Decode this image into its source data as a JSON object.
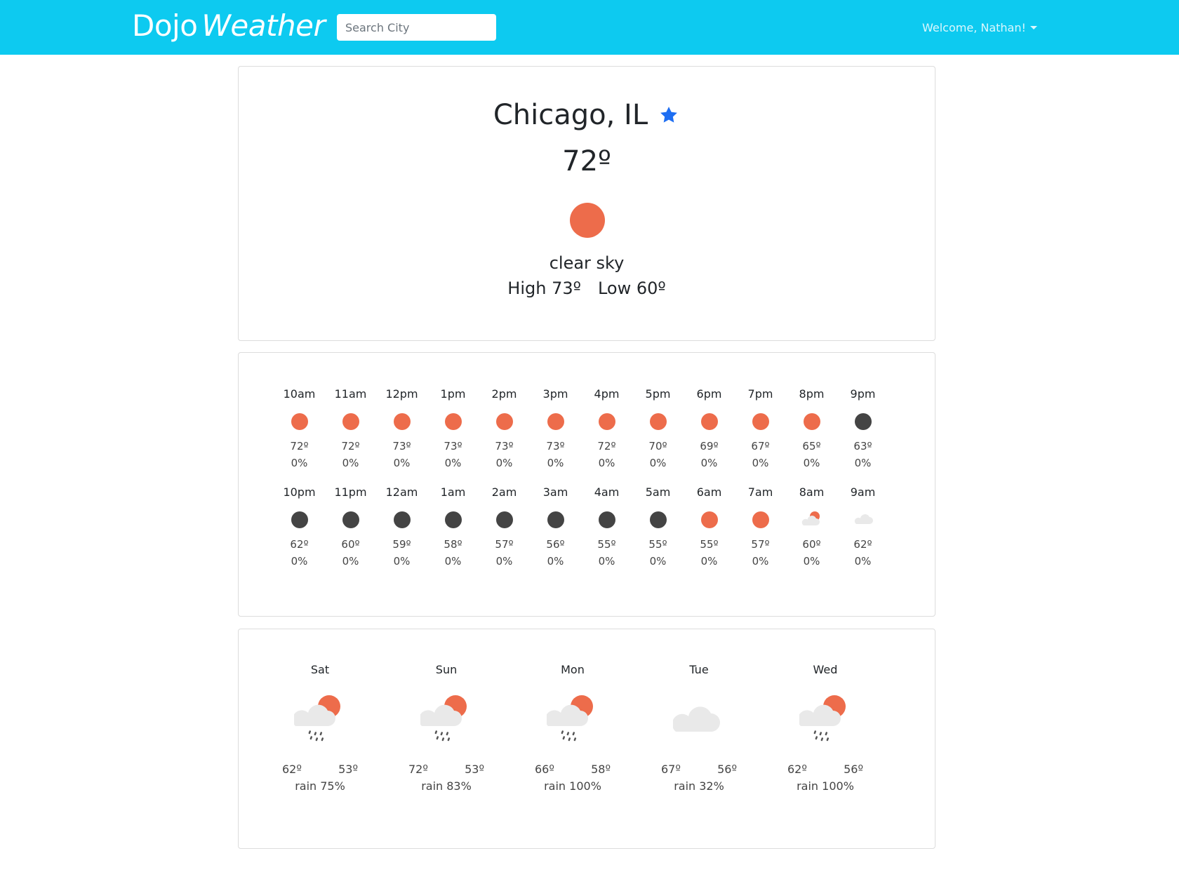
{
  "nav": {
    "brand_part1": "Dojo",
    "brand_part2": "Weather",
    "search_placeholder": "Search City",
    "welcome": "Welcome, Nathan!"
  },
  "current": {
    "city": "Chicago, IL",
    "temp": "72º",
    "icon": "sun-icon",
    "description": "clear sky",
    "high": "High 73º",
    "low": "Low 60º",
    "favorite_icon": "star-icon"
  },
  "hourly": [
    {
      "time": "10am",
      "icon": "sun",
      "temp": "72º",
      "pop": "0%"
    },
    {
      "time": "11am",
      "icon": "sun",
      "temp": "72º",
      "pop": "0%"
    },
    {
      "time": "12pm",
      "icon": "sun",
      "temp": "73º",
      "pop": "0%"
    },
    {
      "time": "1pm",
      "icon": "sun",
      "temp": "73º",
      "pop": "0%"
    },
    {
      "time": "2pm",
      "icon": "sun",
      "temp": "73º",
      "pop": "0%"
    },
    {
      "time": "3pm",
      "icon": "sun",
      "temp": "73º",
      "pop": "0%"
    },
    {
      "time": "4pm",
      "icon": "sun",
      "temp": "72º",
      "pop": "0%"
    },
    {
      "time": "5pm",
      "icon": "sun",
      "temp": "70º",
      "pop": "0%"
    },
    {
      "time": "6pm",
      "icon": "sun",
      "temp": "69º",
      "pop": "0%"
    },
    {
      "time": "7pm",
      "icon": "sun",
      "temp": "67º",
      "pop": "0%"
    },
    {
      "time": "8pm",
      "icon": "sun",
      "temp": "65º",
      "pop": "0%"
    },
    {
      "time": "9pm",
      "icon": "moon",
      "temp": "63º",
      "pop": "0%"
    },
    {
      "time": "10pm",
      "icon": "moon",
      "temp": "62º",
      "pop": "0%"
    },
    {
      "time": "11pm",
      "icon": "moon",
      "temp": "60º",
      "pop": "0%"
    },
    {
      "time": "12am",
      "icon": "moon",
      "temp": "59º",
      "pop": "0%"
    },
    {
      "time": "1am",
      "icon": "moon",
      "temp": "58º",
      "pop": "0%"
    },
    {
      "time": "2am",
      "icon": "moon",
      "temp": "57º",
      "pop": "0%"
    },
    {
      "time": "3am",
      "icon": "moon",
      "temp": "56º",
      "pop": "0%"
    },
    {
      "time": "4am",
      "icon": "moon",
      "temp": "55º",
      "pop": "0%"
    },
    {
      "time": "5am",
      "icon": "moon",
      "temp": "55º",
      "pop": "0%"
    },
    {
      "time": "6am",
      "icon": "sun",
      "temp": "55º",
      "pop": "0%"
    },
    {
      "time": "7am",
      "icon": "sun",
      "temp": "57º",
      "pop": "0%"
    },
    {
      "time": "8am",
      "icon": "partly-cloudy",
      "temp": "60º",
      "pop": "0%"
    },
    {
      "time": "9am",
      "icon": "cloud",
      "temp": "62º",
      "pop": "0%"
    }
  ],
  "daily": [
    {
      "day": "Sat",
      "icon": "rain-sun",
      "high": "62º",
      "low": "53º",
      "cond": "rain 75%"
    },
    {
      "day": "Sun",
      "icon": "rain-sun",
      "high": "72º",
      "low": "53º",
      "cond": "rain 83%"
    },
    {
      "day": "Mon",
      "icon": "rain-sun",
      "high": "66º",
      "low": "58º",
      "cond": "rain 100%"
    },
    {
      "day": "Tue",
      "icon": "cloud",
      "high": "67º",
      "low": "56º",
      "cond": "rain 32%"
    },
    {
      "day": "Wed",
      "icon": "rain-sun",
      "high": "62º",
      "low": "56º",
      "cond": "rain 100%"
    }
  ],
  "colors": {
    "navbar": "#0dcaf0",
    "sun": "#ed6c4b",
    "moon": "#444444",
    "star": "#1e6ef2",
    "cloud": "#e9e9e9"
  }
}
